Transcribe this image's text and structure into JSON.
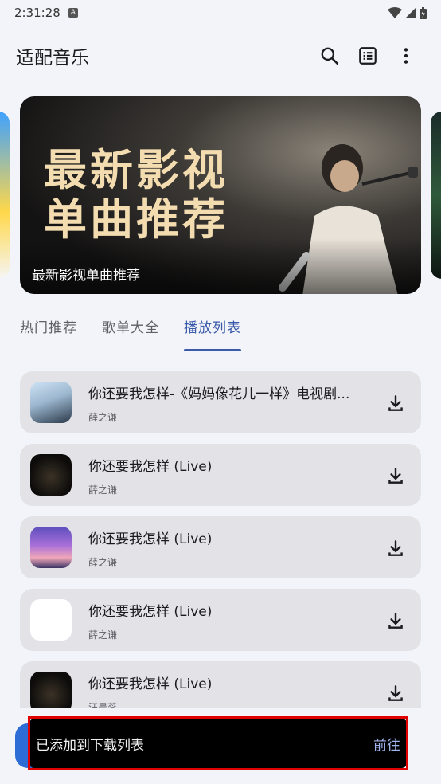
{
  "status_bar": {
    "time": "2:31:28",
    "badge": "A"
  },
  "app_bar": {
    "title": "适配音乐",
    "icons": [
      "search-icon",
      "playlist-icon",
      "more-vert-icon"
    ]
  },
  "banner": {
    "headline_line1": "最新影视",
    "headline_line2": "单曲推荐",
    "caption": "最新影视单曲推荐"
  },
  "tabs": [
    {
      "label": "热门推荐",
      "active": false
    },
    {
      "label": "歌单大全",
      "active": false
    },
    {
      "label": "播放列表",
      "active": true
    }
  ],
  "songs": [
    {
      "title": "你还要我怎样-《妈妈像花儿一样》电视剧...",
      "artist": "薛之谦"
    },
    {
      "title": "你还要我怎样 (Live)",
      "artist": "薛之谦"
    },
    {
      "title": "你还要我怎样 (Live)",
      "artist": "薛之谦"
    },
    {
      "title": "你还要我怎样 (Live)",
      "artist": "薛之谦"
    },
    {
      "title": "你还要我怎样 (Live)",
      "artist": "汪晨蕊"
    }
  ],
  "snackbar": {
    "message": "已添加到下载列表",
    "action": "前往"
  },
  "colors": {
    "accent": "#3a5ba9",
    "background": "#f3f4f9",
    "card": "#e2e2e7",
    "snackbar_action": "#9fb4ec",
    "highlight": "#e00000"
  }
}
